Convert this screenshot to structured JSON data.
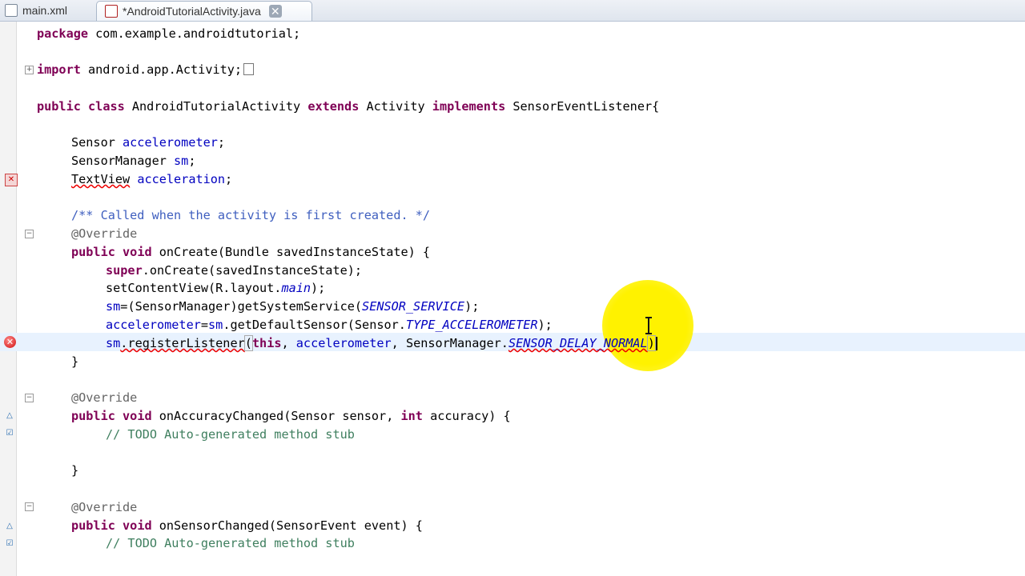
{
  "tabs": [
    {
      "label": "main.xml"
    },
    {
      "label": "*AndroidTutorialActivity.java"
    }
  ],
  "code": {
    "package_kw": "package",
    "package_rest": " com.example.androidtutorial;",
    "import_kw": "import",
    "import_rest": " android.app.Activity;",
    "class_l1": "public",
    "class_l2": " ",
    "class_l3": "class",
    "class_l4": " AndroidTutorialActivity ",
    "class_l5": "extends",
    "class_l6": " Activity ",
    "class_l7": "implements",
    "class_l8": " SensorEventListener{",
    "f1_type": "Sensor ",
    "f1_name": "accelerometer",
    "f1_end": ";",
    "f2_type": "SensorManager ",
    "f2_name": "sm",
    "f2_end": ";",
    "f3_type": "TextView",
    "f3_sp": " ",
    "f3_name": "acceleration",
    "f3_end": ";",
    "doc_comment": "/** Called when the activity is first created. */",
    "override": "@Override",
    "oc_public": "public",
    "oc_void": "void",
    "oc_rest": " onCreate(Bundle savedInstanceState) {",
    "s1_super": "super",
    "s1_rest": ".onCreate(savedInstanceState);",
    "s2_a": "setContentView(R.layout.",
    "s2_b": "main",
    "s2_c": ");",
    "s3_a": "sm",
    "s3_b": "=(SensorManager)getSystemService(",
    "s3_c": "SENSOR_SERVICE",
    "s3_d": ");",
    "s4_a": "accelerometer",
    "s4_b": "=",
    "s4_c": "sm",
    "s4_d": ".getDefaultSensor(Sensor.",
    "s4_e": "TYPE_ACCELEROMETER",
    "s4_f": ");",
    "s5_a": "sm",
    "s5_b": ".registerListener",
    "s5_c": "(",
    "s5_d": "this",
    "s5_e": ", ",
    "s5_f": "accelerometer",
    "s5_g": ", SensorManager.",
    "s5_h": "SENSOR_DELAY_NORMAL",
    "s5_i": ")",
    "close_brace": "}",
    "oac_rest": " onAccuracyChanged(Sensor sensor, ",
    "oac_int": "int",
    "oac_end": " accuracy) {",
    "todo_comment": "// TODO Auto-generated method stub",
    "osc_rest": " onSensorChanged(SensorEvent event) {"
  }
}
